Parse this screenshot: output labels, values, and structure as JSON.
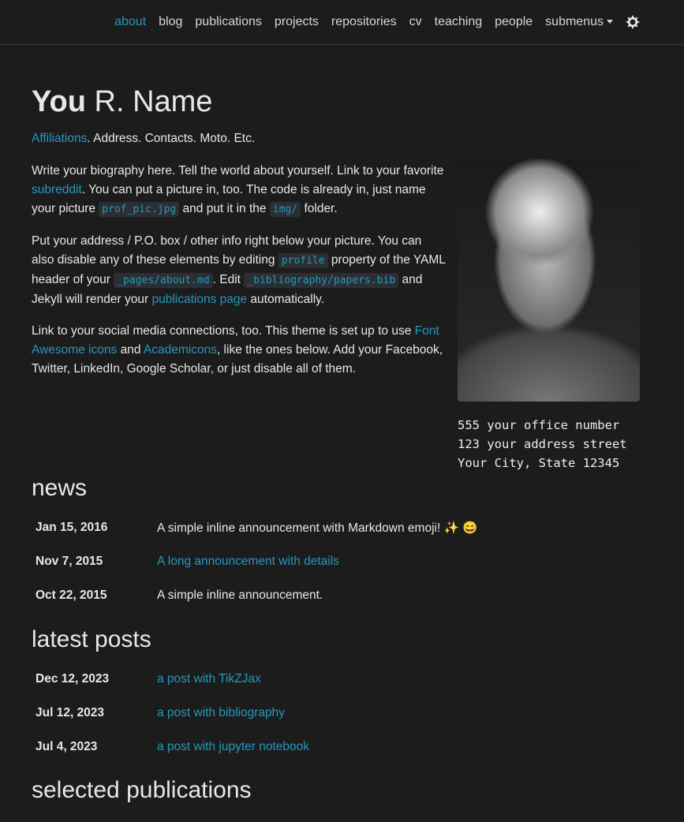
{
  "nav": {
    "items": [
      "about",
      "blog",
      "publications",
      "projects",
      "repositories",
      "cv",
      "teaching",
      "people",
      "submenus"
    ],
    "active": "about"
  },
  "header": {
    "first": "You",
    "rest": " R. Name",
    "affiliations": "Affiliations",
    "desc_rest": ". Address. Contacts. Moto. Etc."
  },
  "bio": {
    "p1": [
      "Write your biography here. Tell the world about yourself. Link to your favorite ",
      "subreddit",
      ". You can put a picture in, too. The code is already in, just name your picture ",
      "prof_pic.jpg",
      " and put it in the ",
      "img/",
      " folder."
    ],
    "p2": [
      "Put your address / P.O. box / other info right below your picture. You can also disable any of these elements by editing ",
      "profile",
      " property of the YAML header of your ",
      "_pages/about.md",
      ". Edit ",
      "_bibliography/papers.bib",
      " and Jekyll will render your ",
      "publications page",
      " automatically."
    ],
    "p3": [
      "Link to your social media connections, too. This theme is set up to use ",
      "Font Awesome icons",
      " and ",
      "Academicons",
      ", like the ones below. Add your Facebook, Twitter, LinkedIn, Google Scholar, or just disable all of them."
    ]
  },
  "address": [
    "555 your office number",
    "123 your address street",
    "Your City, State 12345"
  ],
  "news": {
    "title": "news",
    "items": [
      {
        "date": "Jan 15, 2016",
        "text": "A simple inline announcement with Markdown emoji! ✨ 😄"
      },
      {
        "date": "Nov 7, 2015",
        "text": "A long announcement with details"
      },
      {
        "date": "Oct 22, 2015",
        "text": "A simple inline announcement."
      }
    ]
  },
  "posts": {
    "title": "latest posts",
    "items": [
      {
        "date": "Dec 12, 2023",
        "text": "a post with TikZJax"
      },
      {
        "date": "Jul 12, 2023",
        "text": "a post with bibliography"
      },
      {
        "date": "Jul 4, 2023",
        "text": "a post with jupyter notebook"
      }
    ]
  },
  "publications": {
    "title": "selected publications"
  },
  "colors": {
    "accent": "#2698ba",
    "background": "#1c1c1d"
  }
}
